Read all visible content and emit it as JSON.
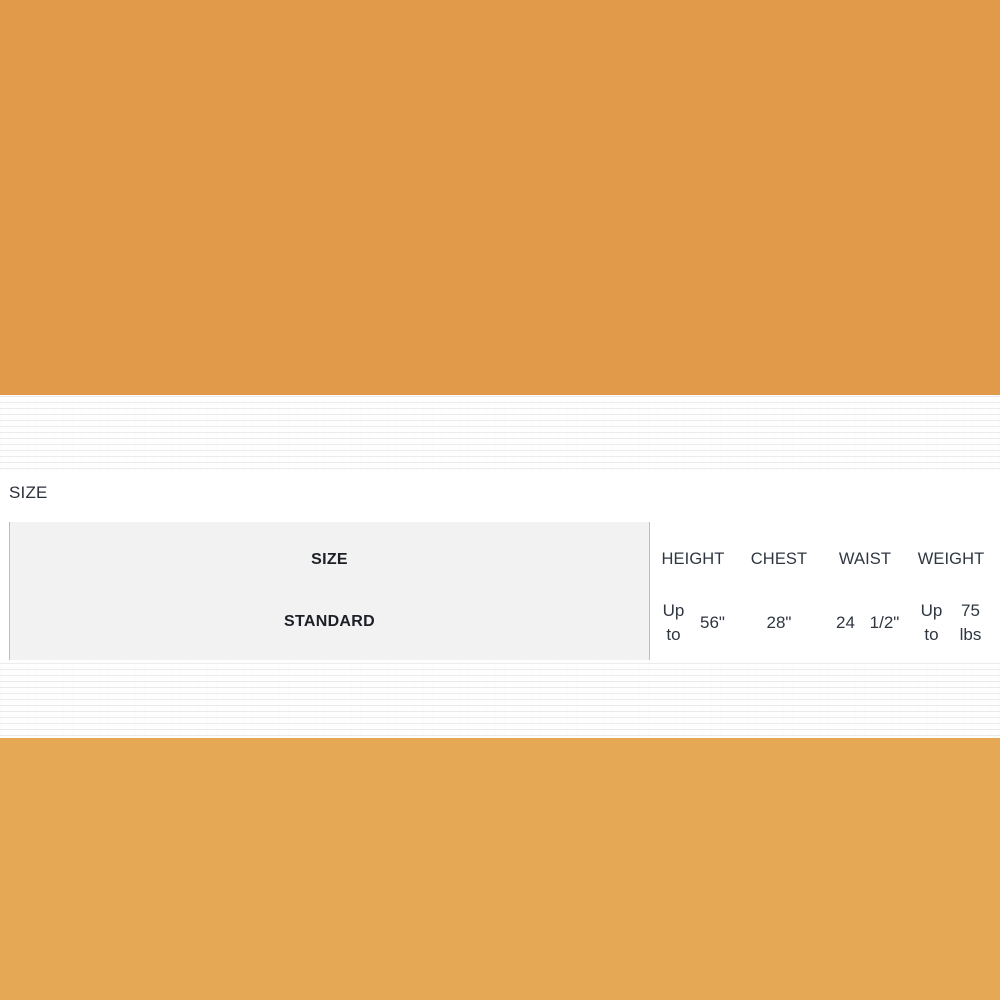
{
  "background": {
    "orange_top_color": "#e09a4a",
    "orange_bottom_color": "#e5a855",
    "texture_band_color": "#f7f7f7",
    "sheet_color": "#ffffff"
  },
  "section": {
    "label": "SIZE"
  },
  "size_table": {
    "size_column": {
      "header": "SIZE",
      "value": "STANDARD",
      "background_color": "#f2f2f2",
      "border_color": "#bdbdbd"
    },
    "columns": [
      {
        "header": "HEIGHT",
        "lines": [
          "Up to",
          "56\""
        ]
      },
      {
        "header": "CHEST",
        "lines": [
          "28\""
        ]
      },
      {
        "header": "WAIST",
        "lines": [
          "24",
          "1/2\""
        ]
      },
      {
        "header": "WEIGHT",
        "lines": [
          "Up to",
          "75 lbs"
        ]
      }
    ]
  }
}
